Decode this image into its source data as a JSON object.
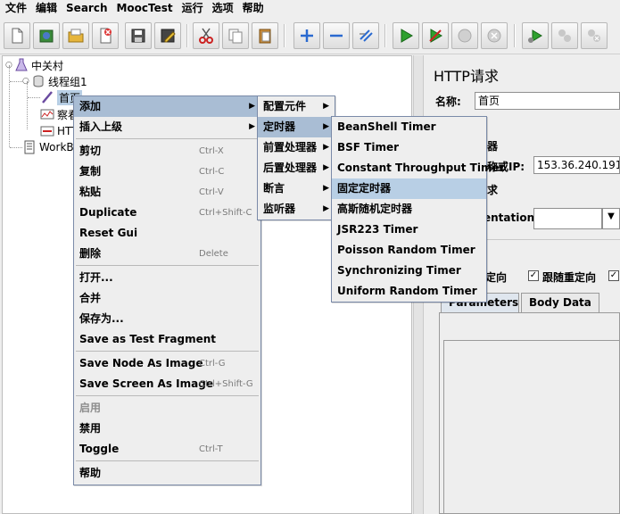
{
  "menubar": [
    "文件",
    "编辑",
    "Search",
    "MoocTest",
    "运行",
    "选项",
    "帮助"
  ],
  "toolbar": {
    "icons": [
      "new-icon",
      "templates-icon",
      "open-icon",
      "close-icon",
      "save-icon",
      "save-as-icon",
      "cut-icon",
      "copy-icon",
      "paste-icon",
      "expand-icon",
      "collapse-icon",
      "toggle-icon",
      "start-icon",
      "start-no-pause-icon",
      "stop-icon",
      "shutdown-icon",
      "remote-start-icon",
      "remote-stop-icon",
      "remote-shutdown-icon"
    ]
  },
  "tree": {
    "root": "中关村",
    "thread_group": "线程组1",
    "child_partial": "首页",
    "node3_partial": "察看",
    "node4_partial": "HTT",
    "workbench_partial": "WorkBe"
  },
  "right": {
    "title": "HTTP请求",
    "name_label": "名称:",
    "name_value": "首页",
    "server_header_partial": "器",
    "server_label_partial": "称或IP:",
    "server_value": "153.36.240.191",
    "partial_heading": "求",
    "impl_label_partial": "entation:",
    "redirect_partial": "定向",
    "follow_redirect": "跟随重定向",
    "tab_params_partial": "Parameters",
    "tab_body": "Body Data"
  },
  "context_menu": {
    "items": [
      {
        "label": "添加",
        "shortcut": "",
        "submenu": true
      },
      {
        "label": "插入上级",
        "shortcut": "",
        "submenu": true
      },
      {
        "label": "剪切",
        "shortcut": "Ctrl-X"
      },
      {
        "label": "复制",
        "shortcut": "Ctrl-C"
      },
      {
        "label": "粘贴",
        "shortcut": "Ctrl-V"
      },
      {
        "label": "Duplicate",
        "shortcut": "Ctrl+Shift-C"
      },
      {
        "label": "Reset Gui",
        "shortcut": ""
      },
      {
        "label": "删除",
        "shortcut": "Delete"
      },
      {
        "label": "打开...",
        "shortcut": ""
      },
      {
        "label": "合并",
        "shortcut": ""
      },
      {
        "label": "保存为...",
        "shortcut": ""
      },
      {
        "label": "Save as Test Fragment",
        "shortcut": ""
      },
      {
        "label": "Save Node As Image",
        "shortcut": "Ctrl-G"
      },
      {
        "label": "Save Screen As Image",
        "shortcut": "Ctrl+Shift-G"
      },
      {
        "label": "启用",
        "shortcut": ""
      },
      {
        "label": "禁用",
        "shortcut": ""
      },
      {
        "label": "Toggle",
        "shortcut": "Ctrl-T"
      },
      {
        "label": "帮助",
        "shortcut": ""
      }
    ]
  },
  "add_menu": {
    "items": [
      "配置元件",
      "定时器",
      "前置处理器",
      "后置处理器",
      "断言",
      "监听器"
    ]
  },
  "timer_menu": {
    "items": [
      "BeanShell Timer",
      "BSF Timer",
      "Constant Throughput Timer",
      "固定定时器",
      "高斯随机定时器",
      "JSR223 Timer",
      "Poisson Random Timer",
      "Synchronizing Timer",
      "Uniform Random Timer"
    ]
  },
  "colors": {
    "highlight": "#b8cfe5",
    "menu_border": "#7a8aa8",
    "background": "#eeeeee"
  }
}
